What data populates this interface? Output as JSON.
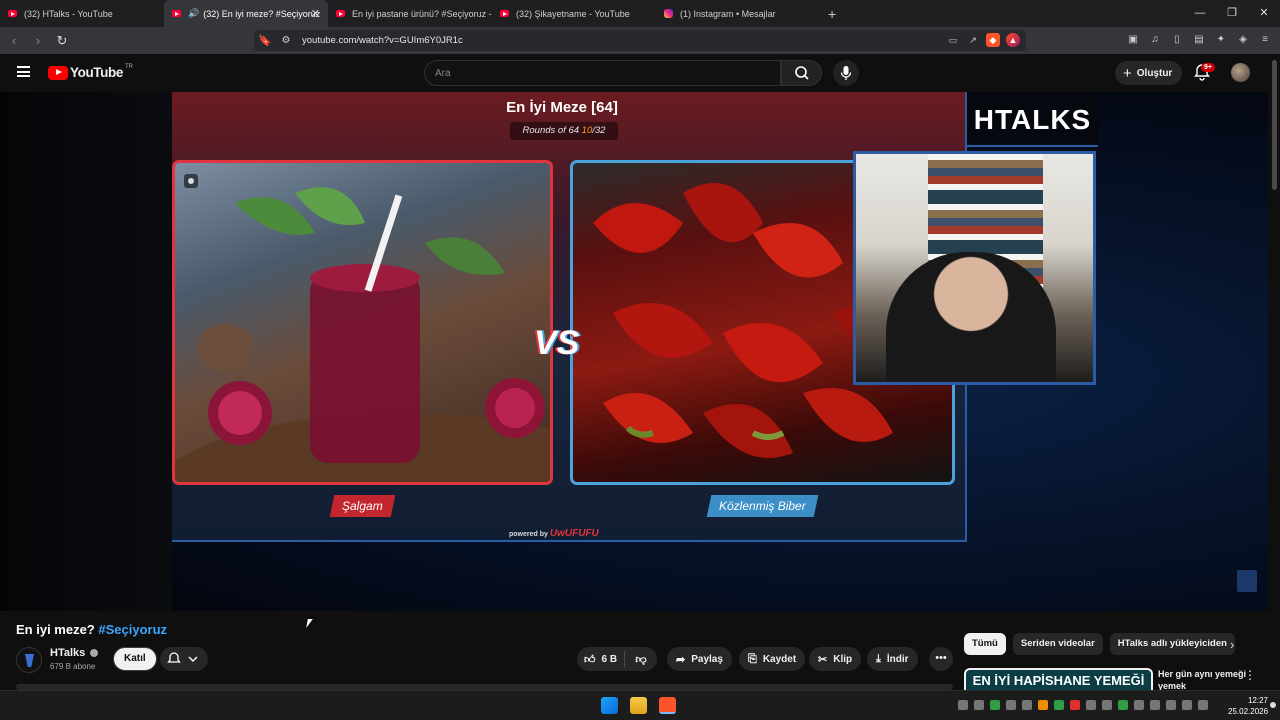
{
  "browser": {
    "tabs": [
      {
        "label": "(32) HTalks - YouTube",
        "icon": "youtube-favicon",
        "active": false
      },
      {
        "label": "(32) En iyi meze? #Seçiyoruz",
        "icon": "youtube-favicon",
        "active": true
      },
      {
        "label": "En iyi pastane ürünü? #Seçiyoruz - Yo",
        "icon": "youtube-favicon",
        "active": false
      },
      {
        "label": "(32) Şikayetname - YouTube",
        "icon": "youtube-favicon",
        "active": false
      },
      {
        "label": "(1) Instagram • Mesajlar",
        "icon": "instagram-favicon",
        "active": false
      }
    ],
    "new_tab": "+",
    "url": "youtube.com/watch?v=GUIm6Y0JR1c"
  },
  "youtube": {
    "logo_text": "YouTube",
    "region": "TR",
    "search_placeholder": "Ara",
    "create_label": "Oluştur",
    "notif_badge": "9+"
  },
  "game": {
    "title": "En İyi Meze [64]",
    "rounds_label": "Rounds of 64",
    "round_current": "10",
    "round_total": "/32",
    "left_option": "Şalgam",
    "right_option": "Közlenmiş Biber",
    "vs": "VS",
    "powered_by": "powered by",
    "powered_brand": "UwUFUFU",
    "stream_logo": "HTALKS"
  },
  "video": {
    "title": "En iyi meze?",
    "hashtag": "#Seçiyoruz",
    "channel": "HTalks",
    "subscribers": "679 B abone",
    "join_label": "Katıl",
    "likes": "6 B",
    "share_label": "Paylaş",
    "save_label": "Kaydet",
    "clip_label": "Klip",
    "download_label": "İndir"
  },
  "sidebar": {
    "chips": [
      "Tümü",
      "Seriden videolar",
      "HTalks adlı yükleyiciden"
    ],
    "rec_thumb_text": "EN İYİ HAPİSHANE YEMEĞİ",
    "rec_title": "Her gün aynı yemeği yemek"
  },
  "taskbar": {
    "time": "12:27",
    "date": "25.02.2026"
  },
  "colors": {
    "youtube_red": "#ff0000",
    "left_card": "#e0353c",
    "right_card": "#4ba3dc",
    "hashtag": "#3ea6ff",
    "round_accent": "#f5a623"
  }
}
